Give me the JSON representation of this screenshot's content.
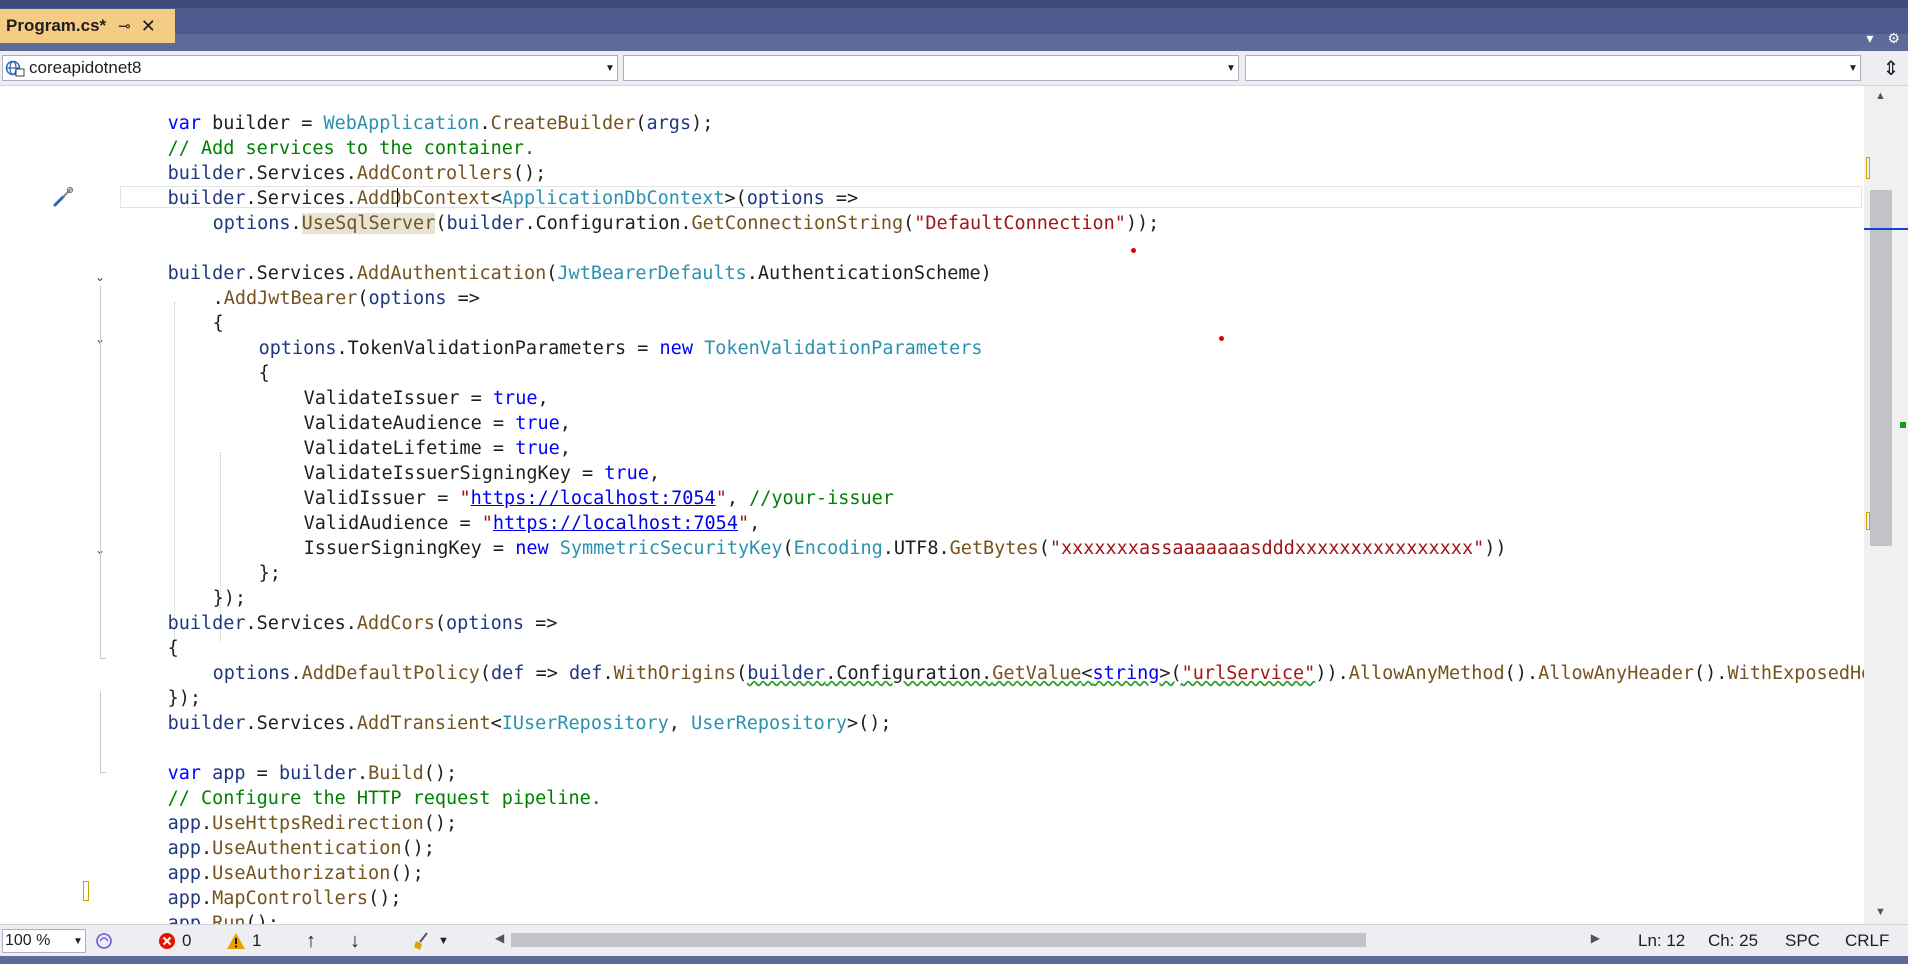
{
  "tab": {
    "title": "Program.cs*",
    "pin_glyph": "⊸",
    "close_glyph": "✕",
    "right_icons": {
      "dropdown": "▾",
      "settings": "⚙"
    }
  },
  "navbar": {
    "project": "coreapidotnet8",
    "type_member": "",
    "member": "",
    "split_glyph": "⇕"
  },
  "code": {
    "l1": {
      "a": "var",
      "b": " builder = ",
      "c": "WebApplication",
      "d": ".",
      "e": "CreateBuilder",
      "f": "(",
      "g": "args",
      "h": ");"
    },
    "l2": "// Add services to the container.",
    "l3": {
      "a": "builder",
      "b": ".Services.",
      "c": "AddControllers",
      "d": "();"
    },
    "l4": {
      "a": "builder",
      "b": ".Services.",
      "c": "AddDbContext",
      "d": "<",
      "e": "ApplicationDbContext",
      "f": ">(",
      "g": "options",
      "h": " =>"
    },
    "l5": {
      "a": "options",
      "b": ".",
      "c": "UseSqlServer",
      "d": "(",
      "e": "builder",
      "f": ".Configuration.",
      "g": "GetConnectionString",
      "h": "(",
      "i": "\"DefaultConnection\"",
      "j": "));"
    },
    "l7": {
      "a": "builder",
      "b": ".Services.",
      "c": "AddAuthentication",
      "d": "(",
      "e": "JwtBearerDefaults",
      "f": ".AuthenticationScheme)"
    },
    "l8": {
      "a": ".",
      "b": "AddJwtBearer",
      "c": "(",
      "d": "options",
      "e": " =>"
    },
    "l9": "{",
    "l10": {
      "a": "options",
      "b": ".TokenValidationParameters = ",
      "c": "new",
      "d": " ",
      "e": "TokenValidationParameters"
    },
    "l11": "{",
    "l12": {
      "a": "ValidateIssuer = ",
      "b": "true",
      "c": ","
    },
    "l13": {
      "a": "ValidateAudience = ",
      "b": "true",
      "c": ","
    },
    "l14": {
      "a": "ValidateLifetime = ",
      "b": "true",
      "c": ","
    },
    "l15": {
      "a": "ValidateIssuerSigningKey = ",
      "b": "true",
      "c": ","
    },
    "l16": {
      "a": "ValidIssuer = ",
      "b": "\"",
      "c": "https://localhost:7054",
      "d": "\"",
      "e": ", ",
      "f": "//your-issuer"
    },
    "l17": {
      "a": "ValidAudience = ",
      "b": "\"",
      "c": "https://localhost:7054",
      "d": "\"",
      "e": ","
    },
    "l18": {
      "a": "IssuerSigningKey = ",
      "b": "new",
      "c": " ",
      "d": "SymmetricSecurityKey",
      "e": "(",
      "f": "Encoding",
      "g": ".UTF8.",
      "h": "GetBytes",
      "i": "(",
      "j": "\"xxxxxxxassaaaaaaasdddxxxxxxxxxxxxxxxx\"",
      "k": "))"
    },
    "l19": "};",
    "l20": "});",
    "l21": {
      "a": "builder",
      "b": ".Services.",
      "c": "AddCors",
      "d": "(",
      "e": "options",
      "f": " =>"
    },
    "l22": "{",
    "l23": {
      "a": "options",
      "b": ".",
      "c": "AddDefaultPolicy",
      "d": "(",
      "e": "def",
      "f": " => ",
      "g": "def",
      "h": ".",
      "i": "WithOrigins",
      "j": "(",
      "k": "builder",
      "l": ".Configuration.",
      "m": "GetValue",
      "n": "<",
      "o": "string",
      "p": ">(",
      "q": "\"urlService\"",
      "r": ")).",
      "s": "AllowAnyMethod",
      "t": "().",
      "u": "AllowAnyHeader",
      "v": "().",
      "w": "WithExposedHe"
    },
    "l24": "});",
    "l25": {
      "a": "builder",
      "b": ".Services.",
      "c": "AddTransient",
      "d": "<",
      "e": "IUserRepository",
      "f": ", ",
      "g": "UserRepository",
      "h": ">();"
    },
    "l27": {
      "a": "var",
      "b": " ",
      "c": "app",
      "d": " = ",
      "e": "builder",
      "f": ".",
      "g": "Build",
      "h": "();"
    },
    "l28": "// Configure the HTTP request pipeline.",
    "l29": {
      "a": "app",
      "b": ".",
      "c": "UseHttpsRedirection",
      "d": "();"
    },
    "l30": {
      "a": "app",
      "b": ".",
      "c": "UseAuthentication",
      "d": "();"
    },
    "l31": {
      "a": "app",
      "b": ".",
      "c": "UseAuthorization",
      "d": "();"
    },
    "l32": {
      "a": "app",
      "b": ".",
      "c": "MapControllers",
      "d": "();"
    },
    "l33": {
      "a": "app",
      "b": ".",
      "c": "Run",
      "d": "();"
    }
  },
  "status": {
    "zoom": "100 %",
    "errors": "0",
    "warnings": "1",
    "line": "Ln: 12",
    "col": "Ch: 25",
    "whitespace": "SPC",
    "line_ending": "CRLF"
  },
  "colors": {
    "tab_active": "#f5cc84",
    "chrome": "#5d6b99",
    "keyword": "#0000ff",
    "type": "#2b91af",
    "method": "#74531f",
    "comment": "#008000",
    "string": "#a31515"
  }
}
